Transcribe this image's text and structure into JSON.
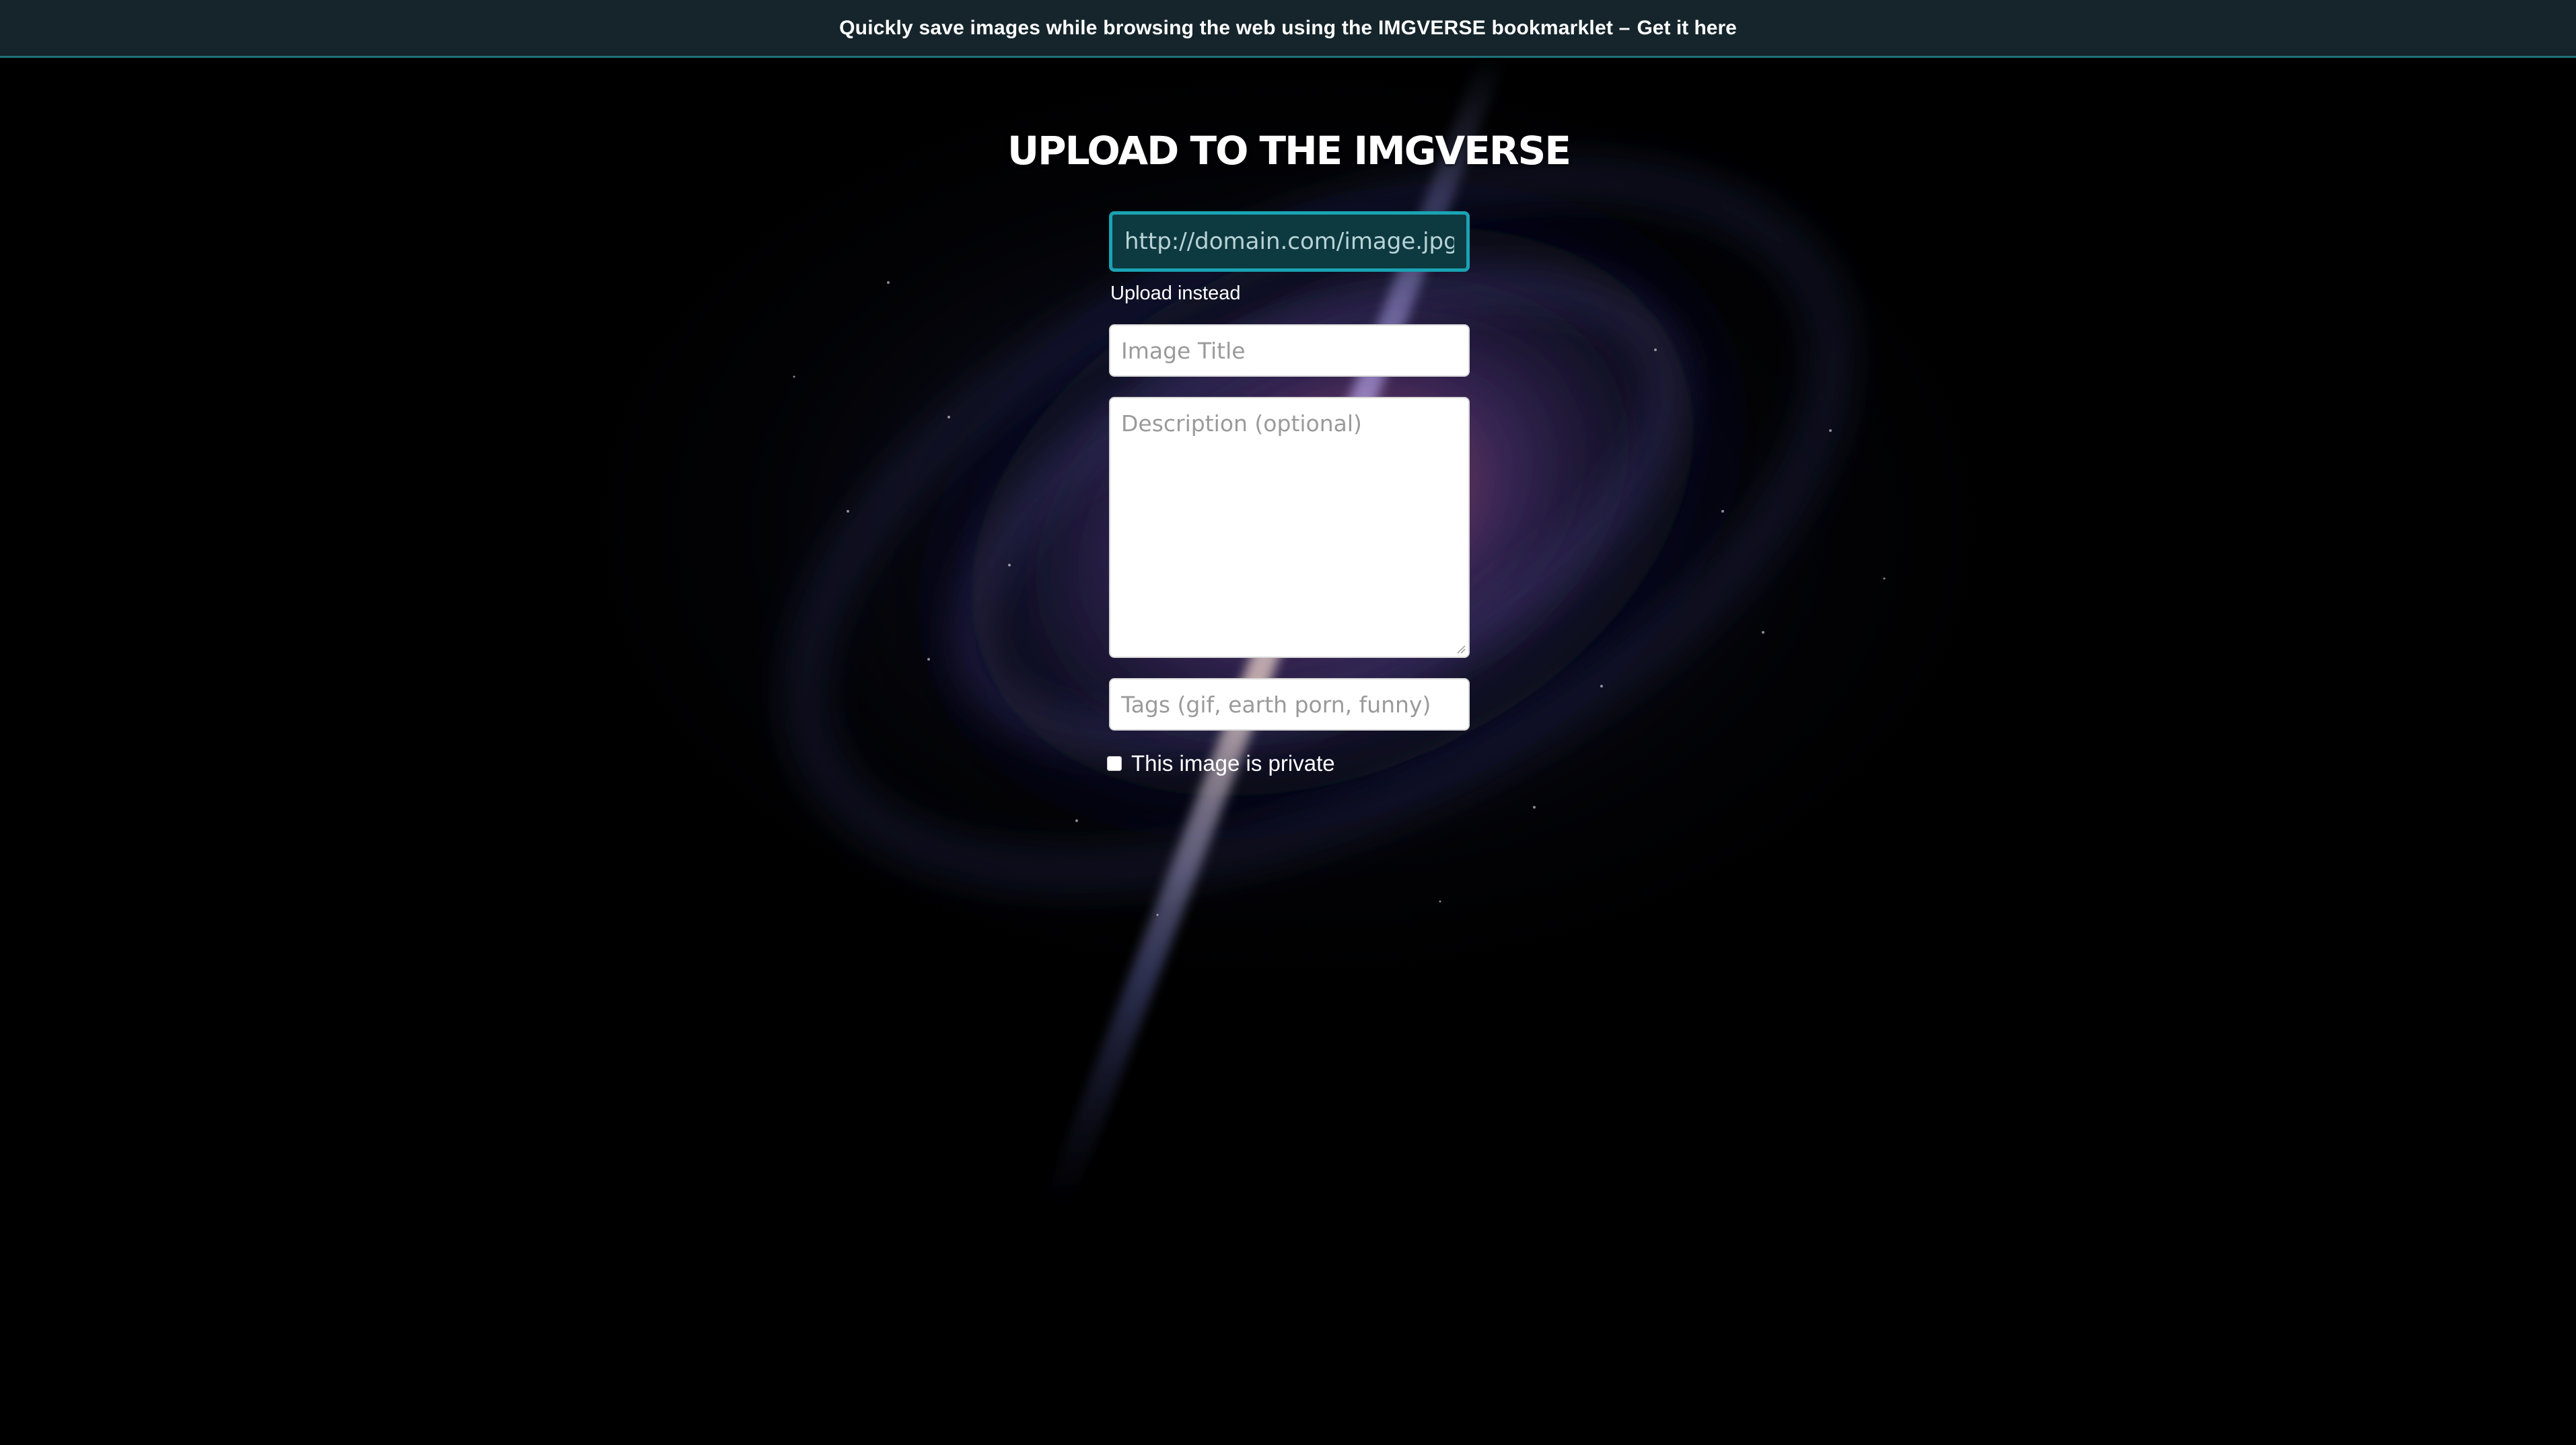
{
  "banner": {
    "text": "Quickly save images while browsing the web using the IMGVERSE bookmarklet –",
    "link_label": "Get it here"
  },
  "form": {
    "heading": "UPLOAD TO THE IMGVERSE",
    "url_placeholder": "http://domain.com/image.jpg",
    "upload_instead_label": "Upload instead",
    "title_placeholder": "Image Title",
    "description_placeholder": "Description (optional)",
    "tags_placeholder": "Tags (gif, earth porn, funny)",
    "private_label": "This image is private",
    "private_checked": false
  },
  "theme": {
    "banner_bg": "#15252b",
    "accent": "#1aa3b4",
    "page_bg": "#000000"
  }
}
